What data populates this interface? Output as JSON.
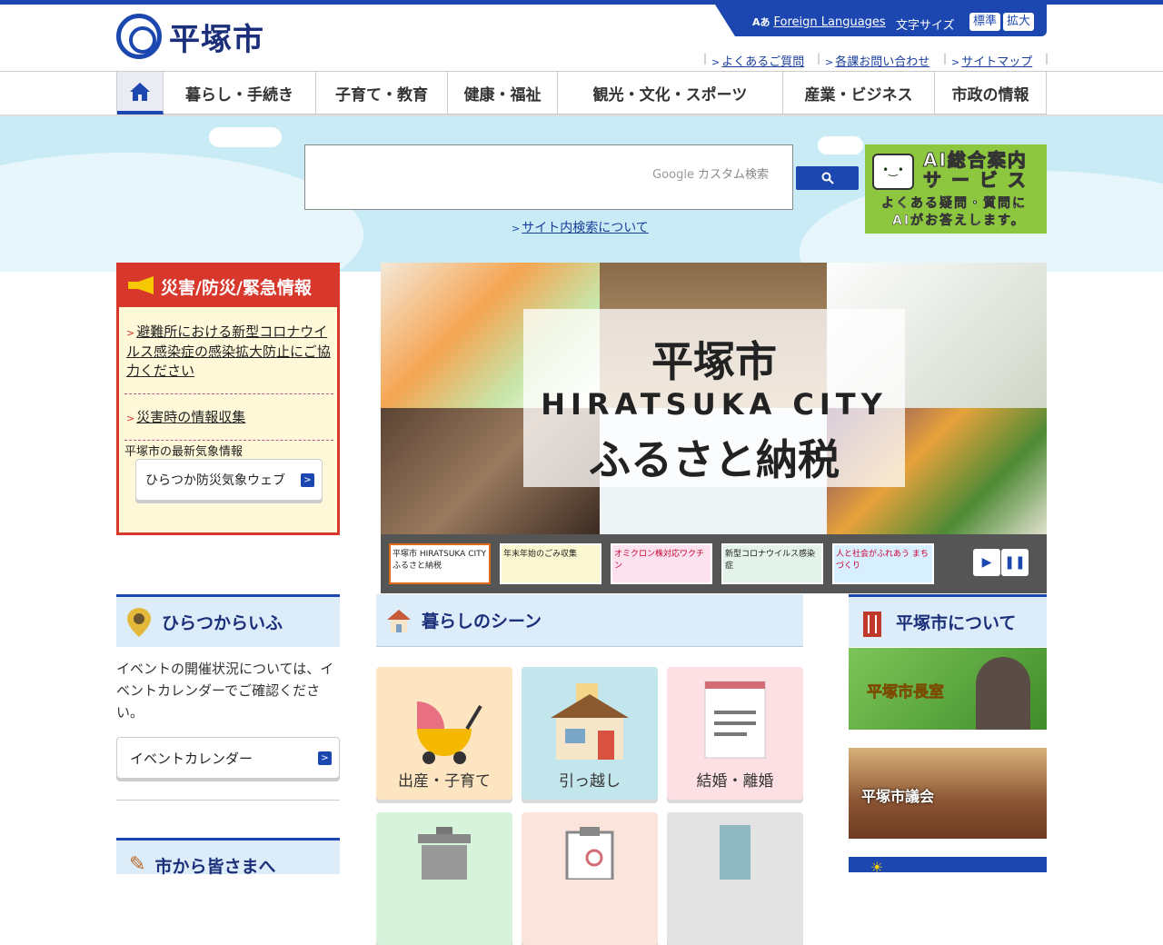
{
  "header": {
    "logo_text": "平塚市",
    "foreign_languages": "Foreign Languages",
    "font_size_label": "文字サイズ",
    "font_standard": "標準",
    "font_large": "拡大",
    "links": [
      "よくあるご質問",
      "各課お問い合わせ",
      "サイトマップ"
    ]
  },
  "nav": {
    "items": [
      "暮らし・手続き",
      "子育て・教育",
      "健康・福祉",
      "観光・文化・スポーツ",
      "産業・ビジネス",
      "市政の情報"
    ]
  },
  "search": {
    "placeholder": "カスタム検索",
    "google_label": "Google",
    "about_link": "サイト内検索について"
  },
  "ai_banner": {
    "title_line1": "AI総合案内",
    "title_line2": "サ ー ビ ス",
    "desc_line1": "よくある疑問・質問に",
    "desc_line2": "AIがお答えします。"
  },
  "disaster": {
    "title": "災害/防災/緊急情報",
    "items": [
      "避難所における新型コロナウイルス感染症の感染拡大防止にご協力ください",
      "災害時の情報収集"
    ],
    "weather_label": "平塚市の最新気象情報",
    "weather_button": "ひらつか防災気象ウェブ"
  },
  "slider": {
    "line1": "平塚市",
    "line2": "HIRATSUKA CITY",
    "line3": "ふるさと納税",
    "thumbs": [
      "平塚市 HIRATSUKA CITY ふるさと納税",
      "年末年始のごみ収集",
      "オミクロン株対応ワクチン",
      "新型コロナウイルス感染症",
      "人と社会がふれあう まちづくり"
    ]
  },
  "life": {
    "title": "ひらつからいふ",
    "text": "イベントの開催状況については、イベントカレンダーでご確認ください。",
    "event_button": "イベントカレンダー"
  },
  "message": {
    "title": "市から皆さまへ"
  },
  "scenes": {
    "title": "暮らしのシーン",
    "tiles": [
      "出産・子育て",
      "引っ越し",
      "結婚・離婚"
    ]
  },
  "about": {
    "title": "平塚市について",
    "mayor": "平塚市長室",
    "assembly": "平塚市議会"
  },
  "colors": {
    "brand": "#1c47b0",
    "alert": "#d8372c",
    "ai_green": "#8dc63f"
  }
}
